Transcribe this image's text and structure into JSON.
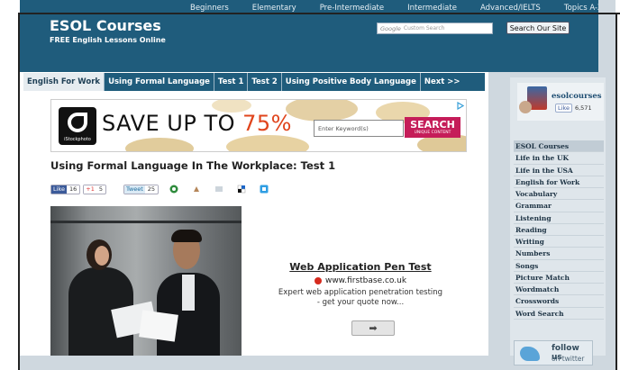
{
  "site": {
    "title": "ESOL Courses",
    "tagline": "FREE English Lessons Online"
  },
  "nav": [
    "Beginners",
    "Elementary",
    "Pre-Intermediate",
    "Intermediate",
    "Advanced/IELTS",
    "Topics A-Z"
  ],
  "search": {
    "google_label": "Google",
    "placeholder": "Custom Search",
    "button": "Search Our Site"
  },
  "tabs": [
    "English For Work",
    "Using Formal Language",
    "Test 1",
    "Test 2",
    "Using Positive Body Language",
    "Next >>"
  ],
  "banner_ad": {
    "brand": "iStockphoto",
    "headline": "SAVE UP TO ",
    "percent": "75%",
    "input_placeholder": "Enter Keyword(s)",
    "button_big": "SEARCH",
    "button_small": "UNIQUE CONTENT",
    "choice_icon": "adchoices-icon"
  },
  "page_title": "Using Formal Language In The Workplace: Test 1",
  "share": {
    "like_label": "Like",
    "like_count": "16",
    "plus_label": "+1",
    "plus_count": "5",
    "tweet_label": "Tweet",
    "tweet_count": "25",
    "icons": [
      "stumbleupon-icon",
      "digg-icon",
      "bookmark-icon",
      "delicious-icon",
      "share-icon"
    ]
  },
  "text_ad": {
    "title": "Web Application Pen Test",
    "url": "www.firstbase.co.uk",
    "description_1": "Expert web application penetration testing",
    "description_2": "- get your quote now...",
    "arrow": "➡"
  },
  "facebook": {
    "name": "esolcourses",
    "like_label": "Like",
    "like_count": "6,571"
  },
  "sidebar_menu": [
    "ESOL Courses",
    "Life in the UK",
    "Life in the USA",
    "English for Work",
    "Vocabulary",
    "Grammar",
    "Listening",
    "Reading",
    "Writing",
    "Numbers",
    "Songs",
    "Picture Match",
    "Wordmatch",
    "Crosswords",
    "Word Search"
  ],
  "follow": {
    "line1": "follow us",
    "line2": "on twitter"
  },
  "colors": {
    "header": "#1f5c7c",
    "accent_pink": "#c51d59",
    "accent_orange": "#e0441c"
  }
}
